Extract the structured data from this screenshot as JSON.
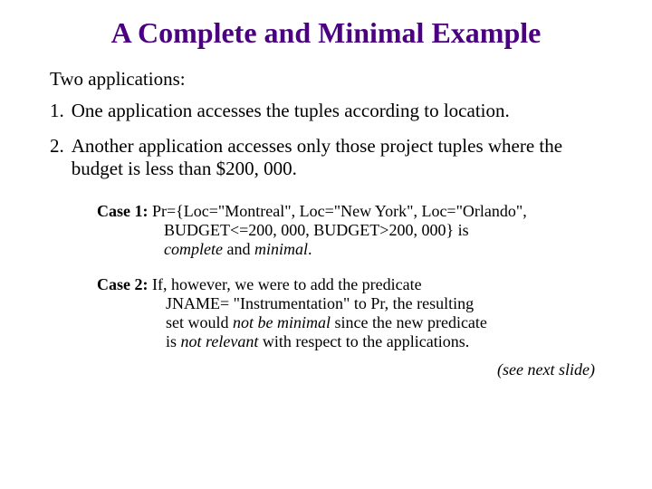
{
  "title": "A Complete and Minimal Example",
  "intro": "Two applications:",
  "items": [
    {
      "num": "1.",
      "text": "One application accesses the tuples according to location."
    },
    {
      "num": "2.",
      "text": "Another application accesses only those project tuples where the budget is less than $200, 000."
    }
  ],
  "case1": {
    "label": "Case 1:",
    "line1": "Pr={Loc=\"Montreal\", Loc=\"New York\", Loc=\"Orlando\",",
    "line2": "BUDGET<=200, 000, BUDGET>200, 000} is",
    "line3_a": "complete",
    "line3_b": " and ",
    "line3_c": "minimal",
    "line3_d": "."
  },
  "case2": {
    "label": "Case 2:",
    "line1": "If, however, we were to add the predicate",
    "line2": "JNAME= \"Instrumentation\" to Pr, the resulting",
    "line3_a": "set would ",
    "line3_b": "not be minimal",
    "line3_c": " since the new predicate",
    "line4_a": "is ",
    "line4_b": "not relevant",
    "line4_c": " with respect to the applications."
  },
  "footer": "(see next slide)"
}
